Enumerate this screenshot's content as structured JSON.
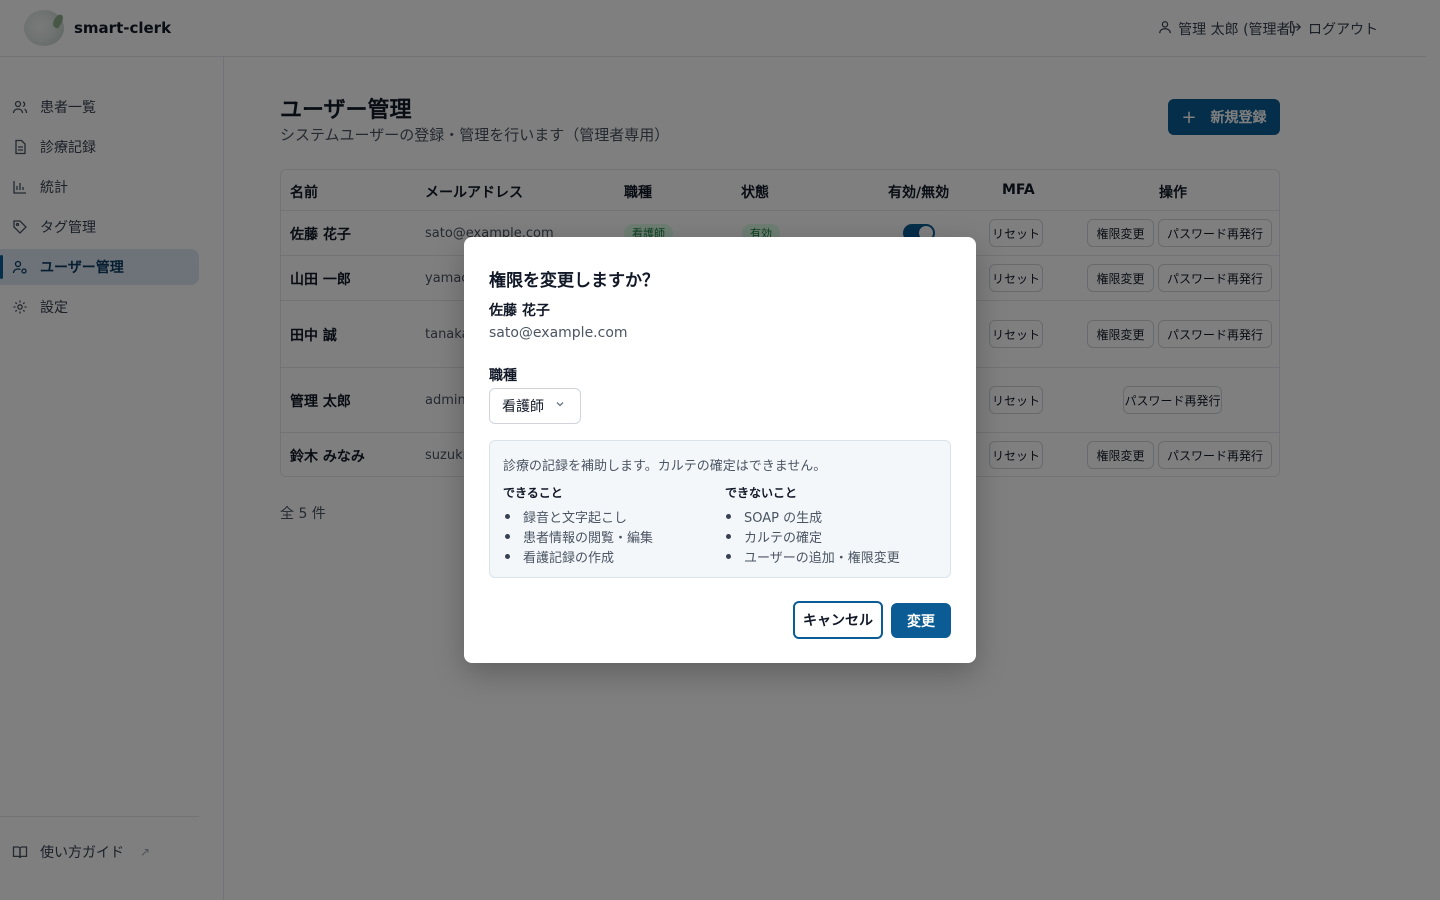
{
  "header": {
    "brand": "smart-clerk",
    "user_label": "管理 太郎 (管理者)",
    "logout_label": "ログアウト"
  },
  "sidebar": {
    "items": [
      {
        "label": "患者一覧",
        "icon": "users-icon"
      },
      {
        "label": "診療記録",
        "icon": "document-icon"
      },
      {
        "label": "統計",
        "icon": "bar-chart-icon"
      },
      {
        "label": "タグ管理",
        "icon": "tag-icon"
      },
      {
        "label": "ユーザー管理",
        "icon": "user-cog-icon",
        "active": true
      },
      {
        "label": "設定",
        "icon": "gear-icon"
      }
    ],
    "guide_label": "使い方ガイド",
    "guide_ext": "↗"
  },
  "main": {
    "title": "ユーザー管理",
    "subtitle": "システムユーザーの登録・管理を行います（管理者専用）",
    "new_button": "新規登録",
    "new_button_icon": "+",
    "count": "全 5 件"
  },
  "table": {
    "headers": [
      "名前",
      "メールアドレス",
      "職種",
      "状態",
      "有効/無効",
      "MFA",
      "操作"
    ],
    "rows": [
      {
        "name": "佐藤 花子",
        "email": "sato@example.com",
        "role": "看護師",
        "status": "有効"
      },
      {
        "name": "山田 一郎",
        "email": "yamac"
      },
      {
        "name": "田中 誠",
        "email": "tanaka"
      },
      {
        "name": "管理 太郎",
        "email": "admin"
      },
      {
        "name": "鈴木 みなみ",
        "email": "suzuki"
      }
    ],
    "reset_label": "リセット",
    "role_change_label": "権限変更",
    "password_reissue_label": "パスワード再発行"
  },
  "modal": {
    "title": "権限を変更しますか？",
    "user_name": "佐藤 花子",
    "user_email": "sato@example.com",
    "role_label": "職種",
    "role_value": "看護師",
    "description": "診療の記録を補助します。カルテの確定はできません。",
    "can_heading": "できること",
    "can_items": [
      "録音と文字起こし",
      "患者情報の閲覧・編集",
      "看護記録の作成"
    ],
    "cannot_heading": "できないこと",
    "cannot_items": [
      "SOAP の生成",
      "カルテの確定",
      "ユーザーの追加・権限変更"
    ],
    "cancel_label": "キャンセル",
    "confirm_label": "変更"
  },
  "colors": {
    "primary": "#0b5c94",
    "active_nav_bg": "#dbe7f1",
    "badge_green_bg": "#dcfce7",
    "badge_green_text": "#15803d",
    "overlay": "rgba(0,0,0,0.5)"
  }
}
